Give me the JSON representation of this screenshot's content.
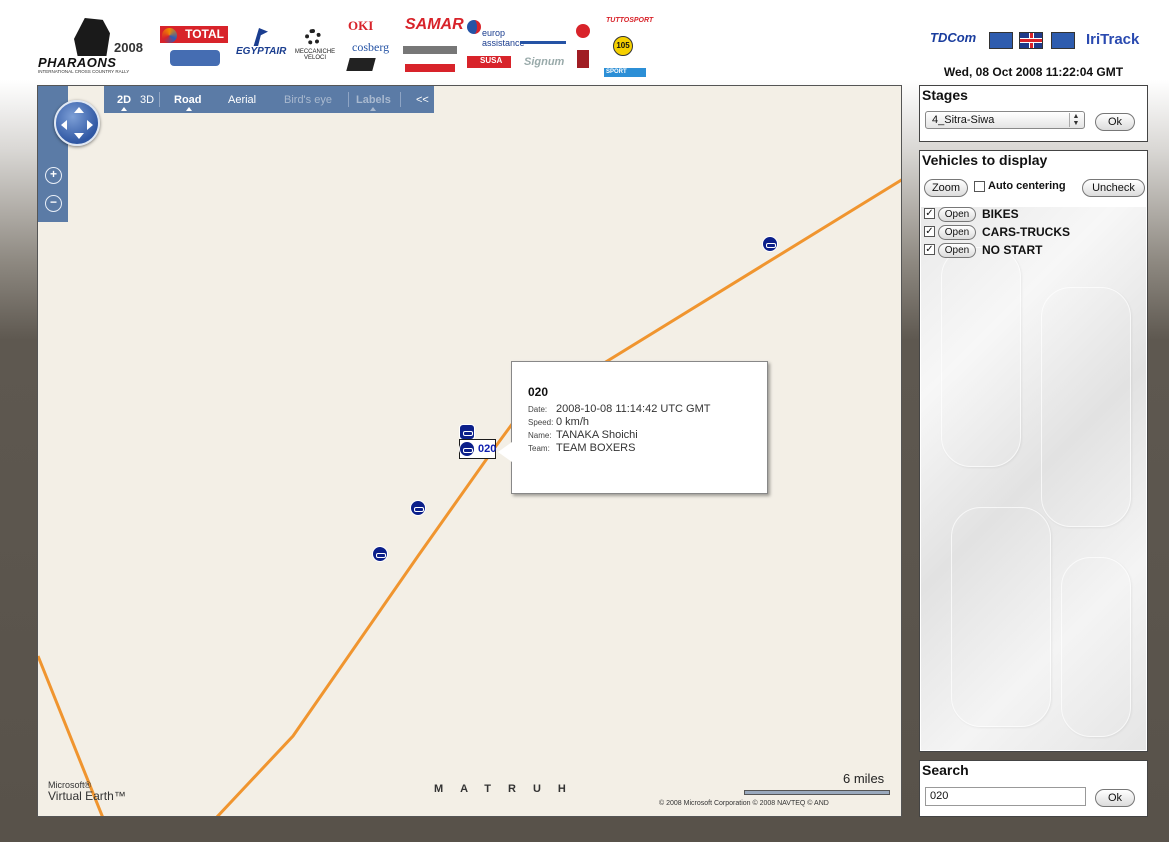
{
  "header": {
    "brand_year": "2008",
    "brand_name": "PHARAONS",
    "brand_subtitle": "INTERNATIONAL CROSS COUNTRY RALLY",
    "sponsors": [
      "TOTAL",
      "EGYPTAIR",
      "MECCANICHE VELOCI",
      "OKI",
      "cosberg",
      "SAMAR",
      "europ assistance",
      "SUSA",
      "Signum",
      "TUTTOSPORT",
      "105",
      "SPORT"
    ],
    "tdcom": "TDCom",
    "iritrack": "IriTrack",
    "datetime": "Wed, 08 Oct 2008 11:22:04 GMT"
  },
  "map": {
    "toolbar": {
      "mode_2d": "2D",
      "mode_3d": "3D",
      "road": "Road",
      "aerial": "Aerial",
      "birds_eye": "Bird's eye",
      "labels": "Labels",
      "collapse": "<<"
    },
    "zoom_in": "+",
    "zoom_out": "−",
    "region_label": "MATRUH",
    "scale_label": "6 miles",
    "ms_line1": "Microsoft®",
    "ms_line2": "Virtual Earth™",
    "copyright": "© 2008 Microsoft Corporation   © 2008 NAVTEQ   © AND",
    "vehicle_label": "020",
    "popup": {
      "title": "020",
      "date_key": "Date:",
      "date": "2008-10-08 11:14:42 UTC GMT",
      "speed_key": "Speed:",
      "speed": "0 km/h",
      "name_key": "Name:",
      "name": "TANAKA Shoichi",
      "team_key": "Team:",
      "team": "TEAM BOXERS"
    }
  },
  "stages": {
    "title": "Stages",
    "selected": "4_Sitra-Siwa",
    "ok": "Ok"
  },
  "vehicles": {
    "title": "Vehicles to display",
    "zoom": "Zoom",
    "auto_centering": "Auto centering",
    "uncheck": "Uncheck",
    "categories": [
      {
        "label": "BIKES",
        "open": "Open",
        "checked": true
      },
      {
        "label": "CARS-TRUCKS",
        "open": "Open",
        "checked": true
      },
      {
        "label": "NO START",
        "open": "Open",
        "checked": true
      }
    ]
  },
  "search": {
    "title": "Search",
    "value": "020",
    "ok": "Ok"
  },
  "colors": {
    "toolbar": "#5b7ba6",
    "road": "#f0952f",
    "map_bg": "#f3efe6",
    "vehicle": "#0b1f8a"
  }
}
